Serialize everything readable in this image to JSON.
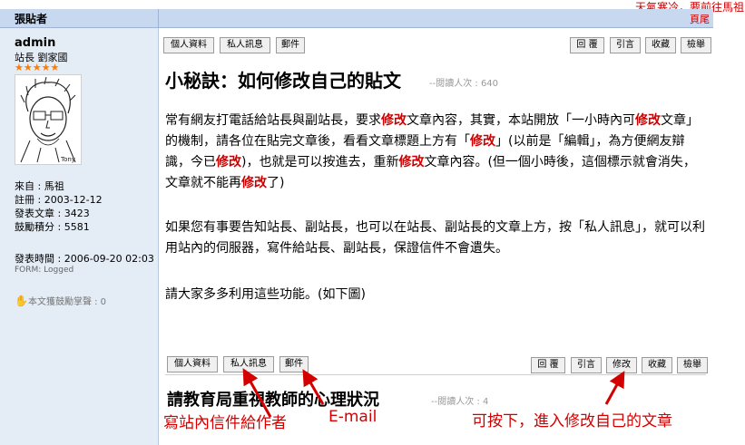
{
  "ticker": "天氣寒冷，要前往馬祖",
  "header": {
    "author_col": "張貼者",
    "page_link": "頁尾"
  },
  "author": {
    "name": "admin",
    "title": "站長 劉家國",
    "stars": "★★★★★",
    "from": "來自 : 馬祖",
    "registered": "註冊 : 2003-12-12",
    "posts": "發表文章 : 3423",
    "points": "鼓勵積分 : 5581",
    "post_time": "發表時間 : 2006-09-20 02:03",
    "form": "FORM: Logged",
    "applause": "本文獲鼓勵掌聲 : 0"
  },
  "toolbar": {
    "profile": "個人資料",
    "pm": "私人訊息",
    "email": "郵件",
    "reply": "回 覆",
    "quote": "引言",
    "fav": "收藏",
    "report": "檢舉",
    "edit": "修改"
  },
  "post": {
    "title": "小秘訣：如何修改自己的貼文",
    "reads": "--閱讀人次 : 640",
    "p1": [
      "常有網友打電話給站長與副站長，要求",
      "修改",
      "文章內容，其實，本站開放「一小時內可",
      "修改",
      "文章」的機制，請各位在貼完文章後，看看文章標題上方有「",
      "修改",
      "」(以前是「編輯」，為方便網友辯識，今已",
      "修改",
      ")，也就是可以按進去，重新",
      "修改",
      "文章內容。(但一個小時後，這個標示就會消失，文章就不能再",
      "修改",
      "了)"
    ],
    "p2": "如果您有事要告知站長、副站長，也可以在站長、副站長的文章上方，按「私人訊息」，就可以利用站內的伺服器，寫件給站長、副站長，保證信件不會遺失。",
    "p3": "請大家多多利用這些功能。(如下圖)"
  },
  "post2": {
    "title": "請教育局重視教師的心理狀況",
    "reads": "--閱讀人次 : 4"
  },
  "annotations": {
    "pm_note": "寫站內信件給作者",
    "email_note": "E-mail",
    "edit_note": "可按下，進入修改自己的文章"
  },
  "colors": {
    "header": "#c8d8ef",
    "sidebar": "#e4ecf5",
    "highlight": "#cc0000",
    "annotation": "#d40000"
  }
}
